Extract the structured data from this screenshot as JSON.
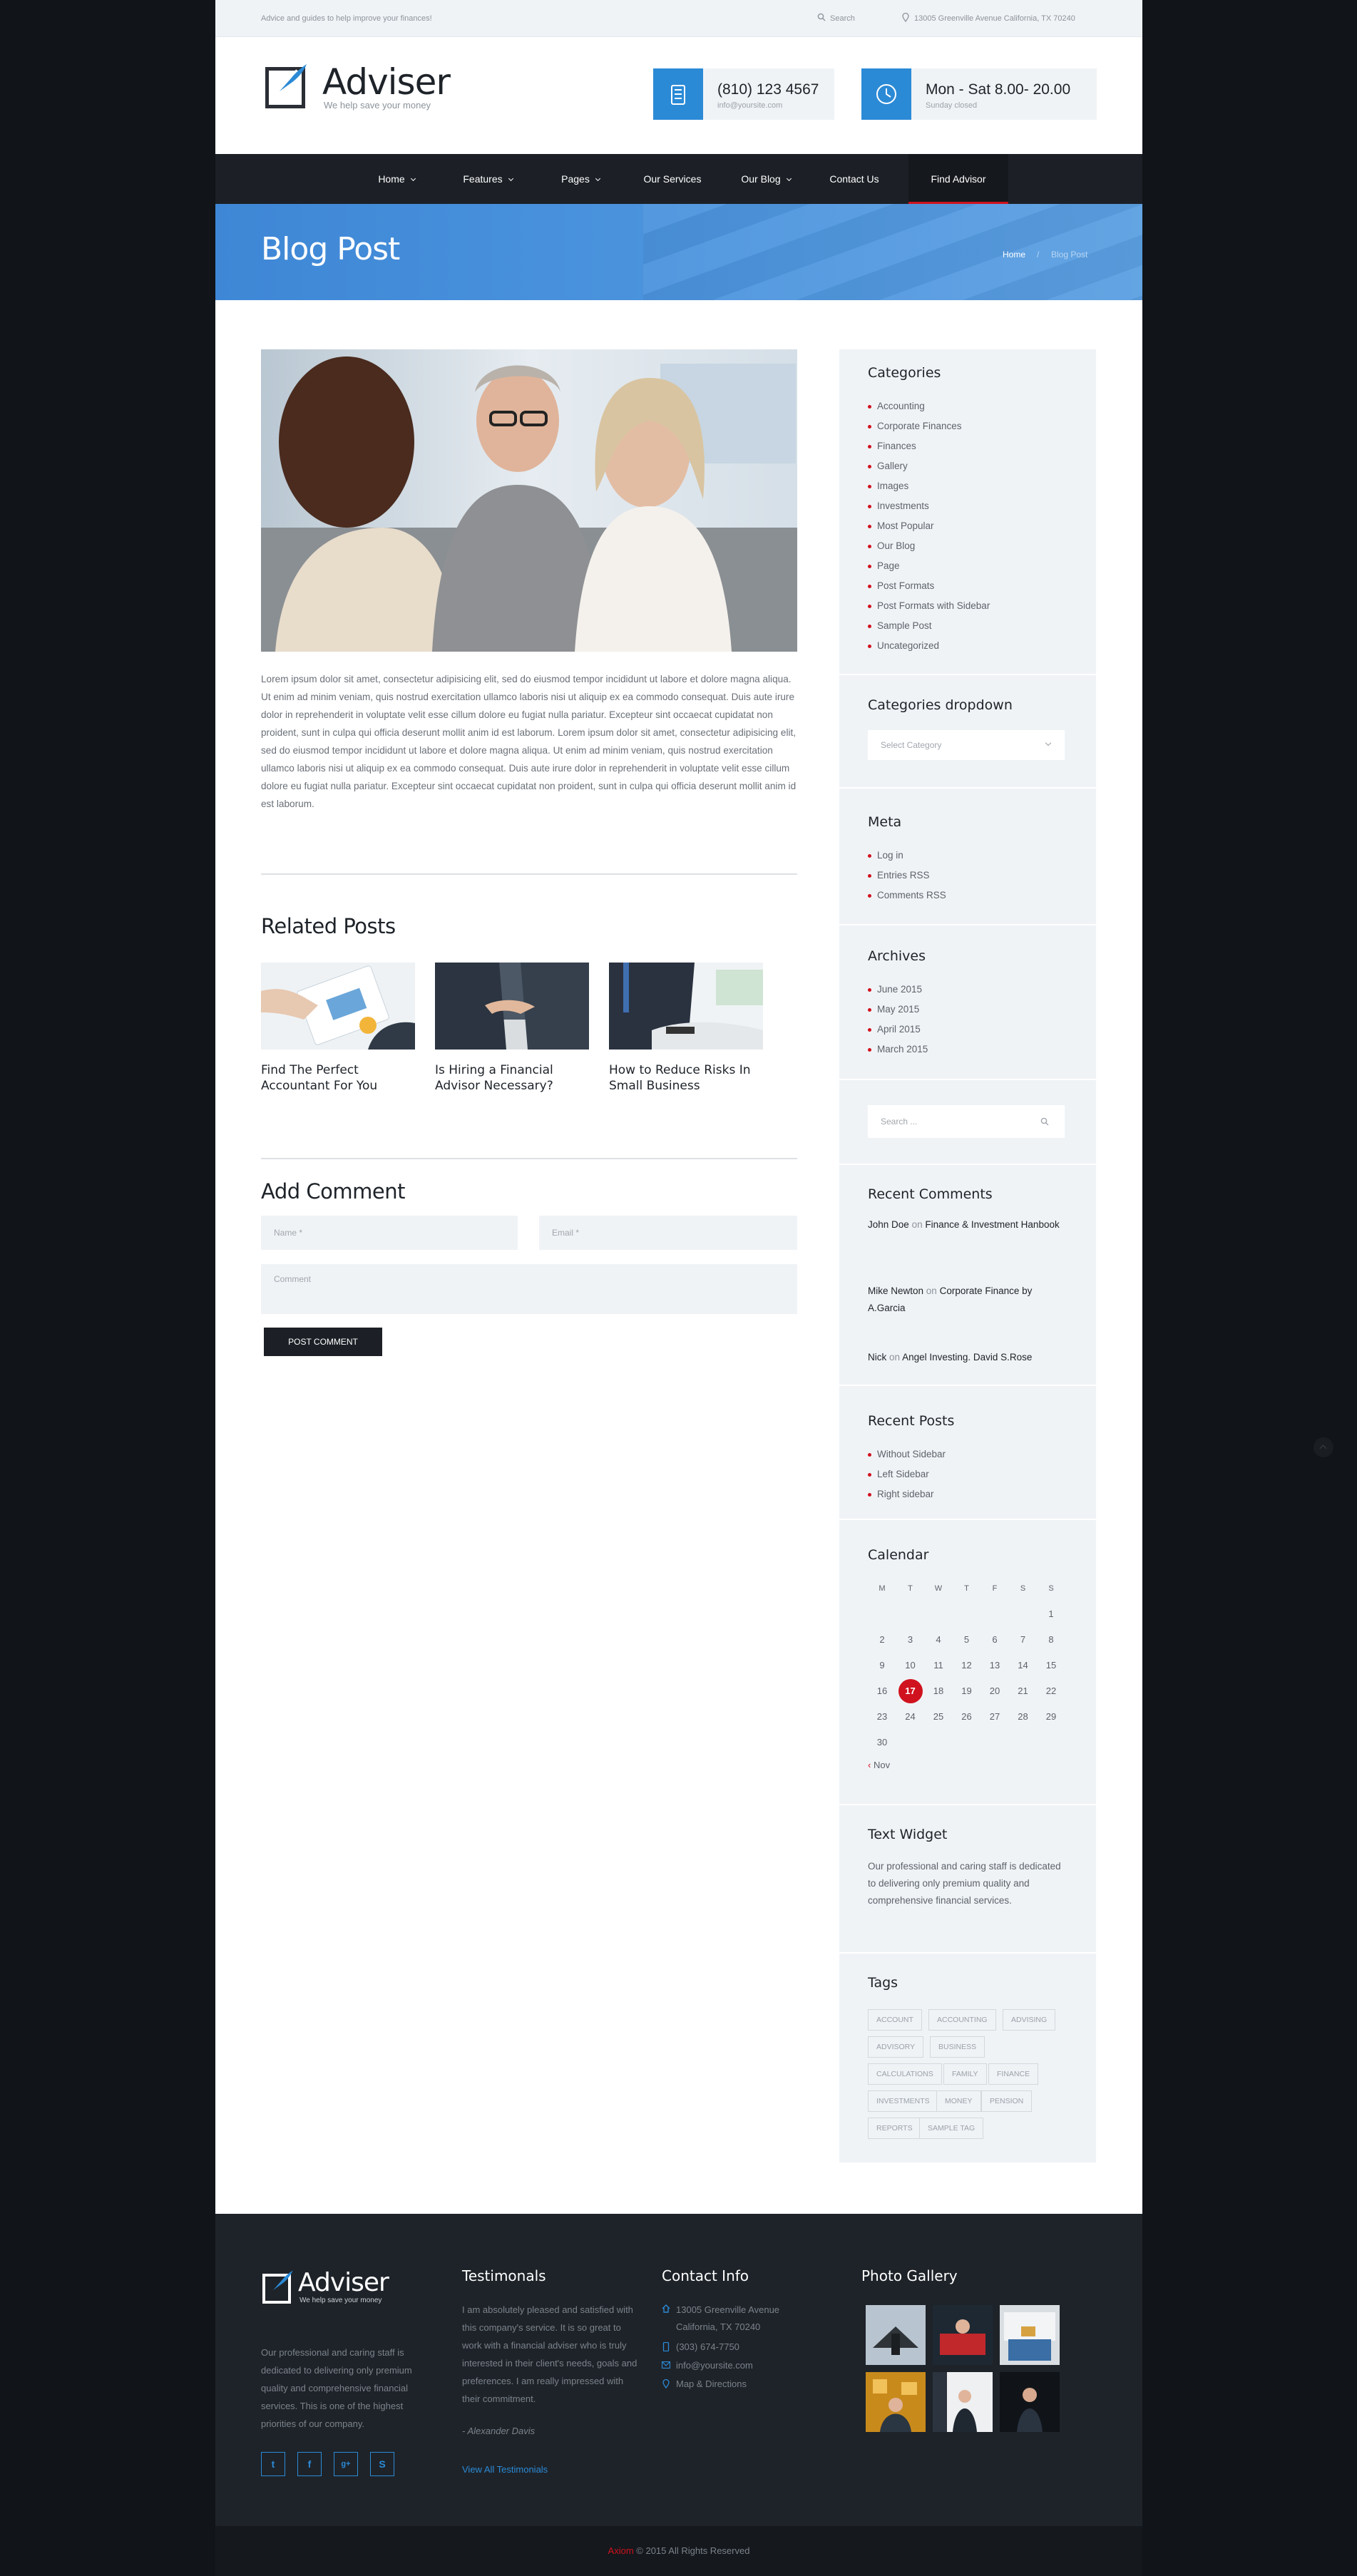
{
  "colors": {
    "accent_blue": "#2b8ad6",
    "accent_red": "#d0121e",
    "dark": "#1c2026",
    "light_bg": "#f0f3f6"
  },
  "topbar": {
    "tagline": "Advice and guides to help improve your finances!",
    "search_label": "Search",
    "address": "13005 Greenville Avenue California, TX 70240",
    "icons": [
      "search-icon",
      "map-pin-icon"
    ]
  },
  "header": {
    "logo_name": "Adviser",
    "logo_tagline": "We help save your money",
    "phone": {
      "main": "(810) 123 4567",
      "sub": "info@yoursite.com",
      "icon": "phone-icon"
    },
    "hours": {
      "main": "Mon - Sat 8.00- 20.00",
      "sub": "Sunday closed",
      "icon": "clock-icon"
    }
  },
  "nav": {
    "items": [
      {
        "label": "Home",
        "dropdown": true
      },
      {
        "label": "Features",
        "dropdown": true
      },
      {
        "label": "Pages",
        "dropdown": true
      },
      {
        "label": "Our Services",
        "dropdown": false
      },
      {
        "label": "Our Blog",
        "dropdown": true
      },
      {
        "label": "Contact Us",
        "dropdown": false
      },
      {
        "label": "Find Advisor",
        "dropdown": false,
        "active": true
      }
    ]
  },
  "banner": {
    "title": "Blog Post",
    "breadcrumb_home": "Home",
    "breadcrumb_sep": "/",
    "breadcrumb_current": "Blog Post"
  },
  "article": {
    "body": "Lorem ipsum dolor sit amet, consectetur adipisicing elit, sed do eiusmod tempor incididunt ut labore et dolore magna aliqua. Ut enim ad minim veniam, quis nostrud exercitation ullamco laboris nisi ut aliquip ex ea commodo consequat. Duis aute irure dolor in reprehenderit in voluptate velit esse cillum dolore eu fugiat nulla pariatur. Excepteur sint occaecat cupidatat non proident, sunt in culpa qui officia deserunt mollit anim id est laborum. Lorem ipsum dolor sit amet, consectetur adipisicing elit, sed do eiusmod tempor incididunt ut labore et dolore magna aliqua. Ut enim ad minim veniam, quis nostrud exercitation ullamco laboris nisi ut aliquip ex ea commodo consequat. Duis aute irure dolor in reprehenderit in voluptate velit esse cillum dolore eu fugiat nulla pariatur. Excepteur sint occaecat cupidatat non proident, sunt in culpa qui officia deserunt mollit anim id est laborum."
  },
  "related": {
    "heading": "Related Posts",
    "posts": [
      {
        "title": "Find The Perfect Accountant For You"
      },
      {
        "title": "Is Hiring a Financial Advisor Necessary?"
      },
      {
        "title": "How to Reduce Risks In Small Business"
      }
    ]
  },
  "comment": {
    "heading": "Add Comment",
    "name_placeholder": "Name *",
    "email_placeholder": "Email *",
    "comment_placeholder": "Comment",
    "submit_label": "POST COMMENT"
  },
  "sidebar": {
    "categories": {
      "heading": "Categories",
      "items": [
        "Accounting",
        "Corporate Finances",
        "Finances",
        "Gallery",
        "Images",
        "Investments",
        "Most Popular",
        "Our Blog",
        "Page",
        "Post Formats",
        "Post Formats with Sidebar",
        "Sample Post",
        "Uncategorized"
      ]
    },
    "dropdown": {
      "heading": "Categories dropdown",
      "selected": "Select Category"
    },
    "meta": {
      "heading": "Meta",
      "items": [
        "Log in",
        "Entries RSS",
        "Comments RSS"
      ]
    },
    "archives": {
      "heading": "Archives",
      "items": [
        "June 2015",
        "May 2015",
        "April 2015",
        "March 2015"
      ]
    },
    "search": {
      "placeholder": "Search ..."
    },
    "recent_comments": {
      "heading": "Recent Comments",
      "items": [
        {
          "author": "John Doe",
          "on": "on",
          "post": "Finance & Investment Hanbook"
        },
        {
          "author": "Mike Newton",
          "on": "on",
          "post": "Corporate Finance by A.Garcia"
        },
        {
          "author": "Nick",
          "on": "on",
          "post": "Angel Investing. David S.Rose"
        }
      ]
    },
    "recent_posts": {
      "heading": "Recent Posts",
      "items": [
        "Without Sidebar",
        "Left Sidebar",
        "Right sidebar"
      ]
    },
    "calendar": {
      "heading": "Calendar",
      "days": [
        "M",
        "T",
        "W",
        "T",
        "F",
        "S",
        "S"
      ],
      "weeks": [
        [
          "",
          "",
          "",
          "",
          "",
          "",
          "1"
        ],
        [
          "2",
          "3",
          "4",
          "5",
          "6",
          "7",
          "8"
        ],
        [
          "9",
          "10",
          "11",
          "12",
          "13",
          "14",
          "15"
        ],
        [
          "16",
          "17",
          "18",
          "19",
          "20",
          "21",
          "22"
        ],
        [
          "23",
          "24",
          "25",
          "26",
          "27",
          "28",
          "29"
        ],
        [
          "30",
          "",
          "",
          "",
          "",
          "",
          ""
        ]
      ],
      "today": "17",
      "prev_label": "Nov",
      "prev_symbol": "‹"
    },
    "text_widget": {
      "heading": "Text Widget",
      "text": "Our professional and caring staff is dedicated to delivering only premium quality and comprehensive financial services."
    },
    "tags": {
      "heading": "Tags",
      "rows": [
        [
          "ACCOUNT",
          "ACCOUNTING",
          "ADVISING"
        ],
        [
          "ADVISORY",
          "BUSINESS"
        ],
        [
          "CALCULATIONS",
          "FAMILY",
          "FINANCE"
        ],
        [
          "INVESTMENTS",
          "MONEY",
          "PENSION"
        ],
        [
          "REPORTS",
          "SAMPLE TAG"
        ]
      ]
    }
  },
  "footer": {
    "logo_name": "Adviser",
    "logo_tagline": "We help save your money",
    "about": "Our professional and caring staff is dedicated to delivering only premium quality and comprehensive financial services. This is one of the highest priorities of our company.",
    "social": [
      {
        "icon": "twitter-icon",
        "glyph": "t"
      },
      {
        "icon": "facebook-icon",
        "glyph": "f"
      },
      {
        "icon": "google-plus-icon",
        "glyph": "g+"
      },
      {
        "icon": "skype-icon",
        "glyph": "S"
      }
    ],
    "testimonials": {
      "heading": "Testimonals",
      "quote": "I am absolutely pleased and satisfied with this company's service. It is so great to work with a financial adviser who is truly interested in their client's needs, goals and preferences. I am really impressed with their commitment.",
      "author": "- Alexander Davis",
      "link": "View All Testimonials"
    },
    "contact": {
      "heading": "Contact Info",
      "address1": "13005 Greenville Avenue",
      "address2": "California, TX 70240",
      "phone": "(303) 674-7750",
      "email": "info@yoursite.com",
      "map": "Map & Directions"
    },
    "gallery": {
      "heading": "Photo Gallery"
    },
    "copyright_brand": "Axiom",
    "copyright_text": "© 2015 All Rights Reserved"
  }
}
